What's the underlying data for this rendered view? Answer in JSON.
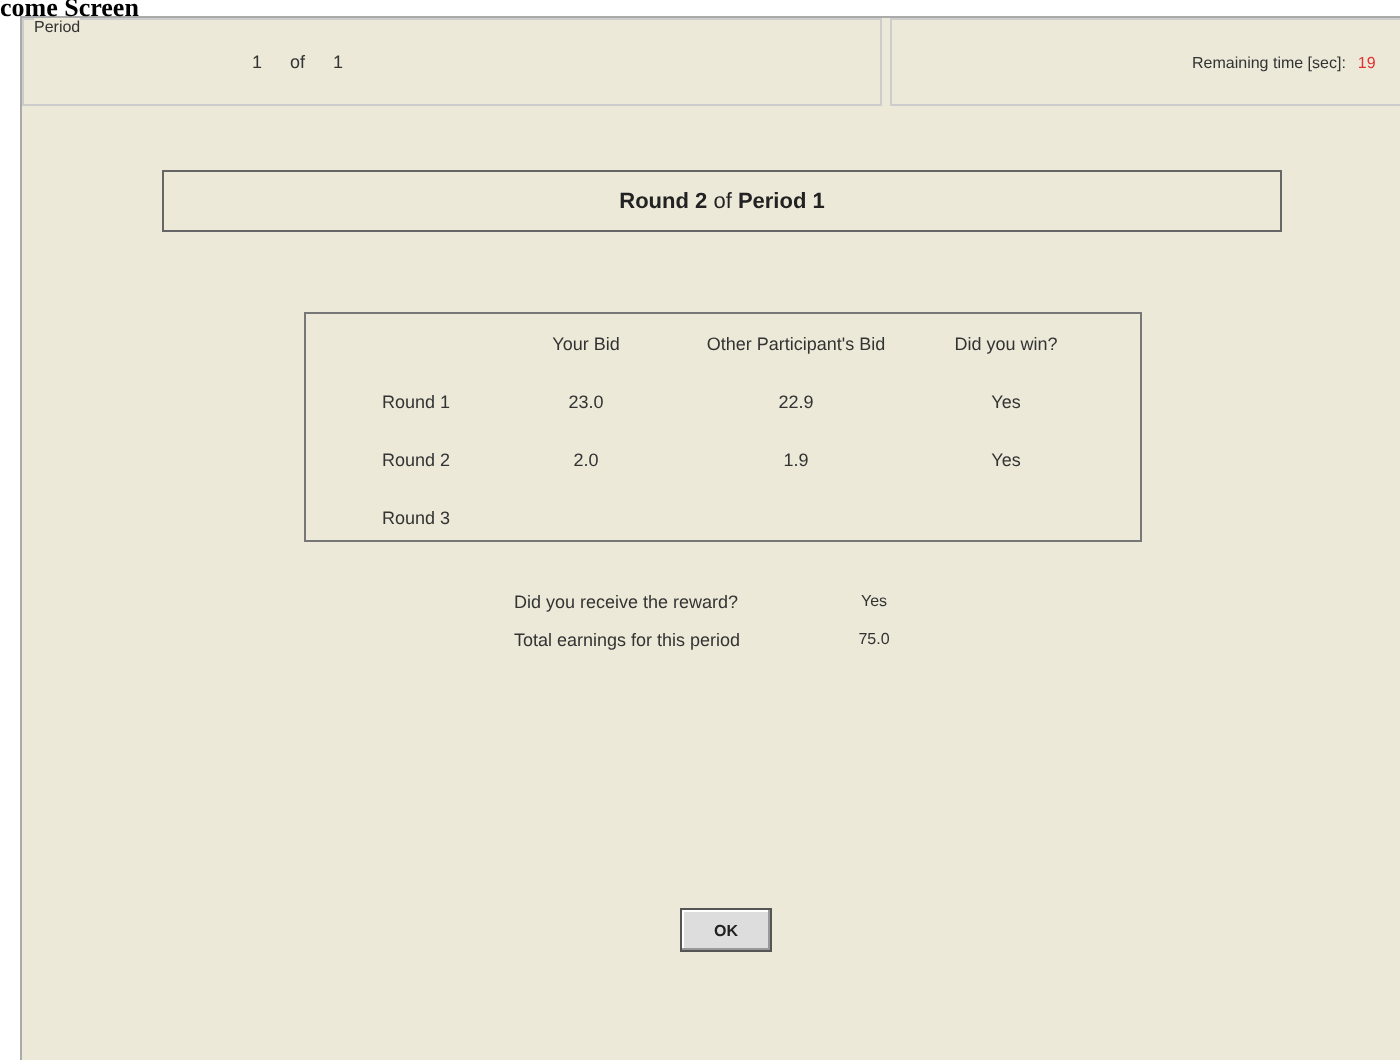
{
  "screen_title": "come Screen",
  "period": {
    "label": "Period",
    "current": "1",
    "of": "of",
    "total": "1"
  },
  "timer": {
    "label": "Remaining time [sec]:",
    "value": "19"
  },
  "round_heading": "**Round 2** of **Period 1**",
  "table": {
    "columns": [
      "Your Bid",
      "Other Participant's Bid",
      "Did you win?"
    ],
    "rows": [
      {
        "label": "Round 1",
        "cells": [
          "23.0",
          "22.9",
          "Yes"
        ]
      },
      {
        "label": "Round 2",
        "cells": [
          "2.0",
          "1.9",
          "Yes"
        ]
      },
      {
        "label": "Round 3",
        "cells": [
          "",
          "",
          ""
        ]
      }
    ]
  },
  "summary": [
    {
      "label": "Did you receive the reward?",
      "value": "Yes"
    },
    {
      "label": "Total earnings for this period",
      "value": "75.0"
    }
  ],
  "ok_button": "OK"
}
